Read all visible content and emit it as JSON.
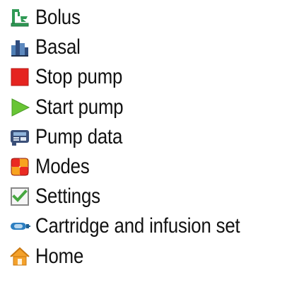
{
  "menu": {
    "items": [
      {
        "id": "bolus",
        "label": "Bolus",
        "icon": "bolus-icon"
      },
      {
        "id": "basal",
        "label": "Basal",
        "icon": "basal-icon"
      },
      {
        "id": "stop-pump",
        "label": "Stop pump",
        "icon": "stop-square-icon"
      },
      {
        "id": "start-pump",
        "label": "Start pump",
        "icon": "play-triangle-icon"
      },
      {
        "id": "pump-data",
        "label": "Pump data",
        "icon": "pump-data-icon"
      },
      {
        "id": "modes",
        "label": "Modes",
        "icon": "modes-grid-icon"
      },
      {
        "id": "settings",
        "label": "Settings",
        "icon": "checkbox-icon"
      },
      {
        "id": "cartridge",
        "label": "Cartridge and infusion set",
        "icon": "cartridge-icon"
      },
      {
        "id": "home",
        "label": "Home",
        "icon": "home-icon"
      }
    ]
  },
  "colors": {
    "text": "#111111",
    "stop": "#e52420",
    "start": "#68c534",
    "bolus_green": "#2f9a55",
    "modes_red": "#ea2a22",
    "modes_orange": "#f8a320",
    "settings_green": "#46a740",
    "cartridge_blue": "#2d7fc1",
    "home_orange": "#f4a12a"
  }
}
